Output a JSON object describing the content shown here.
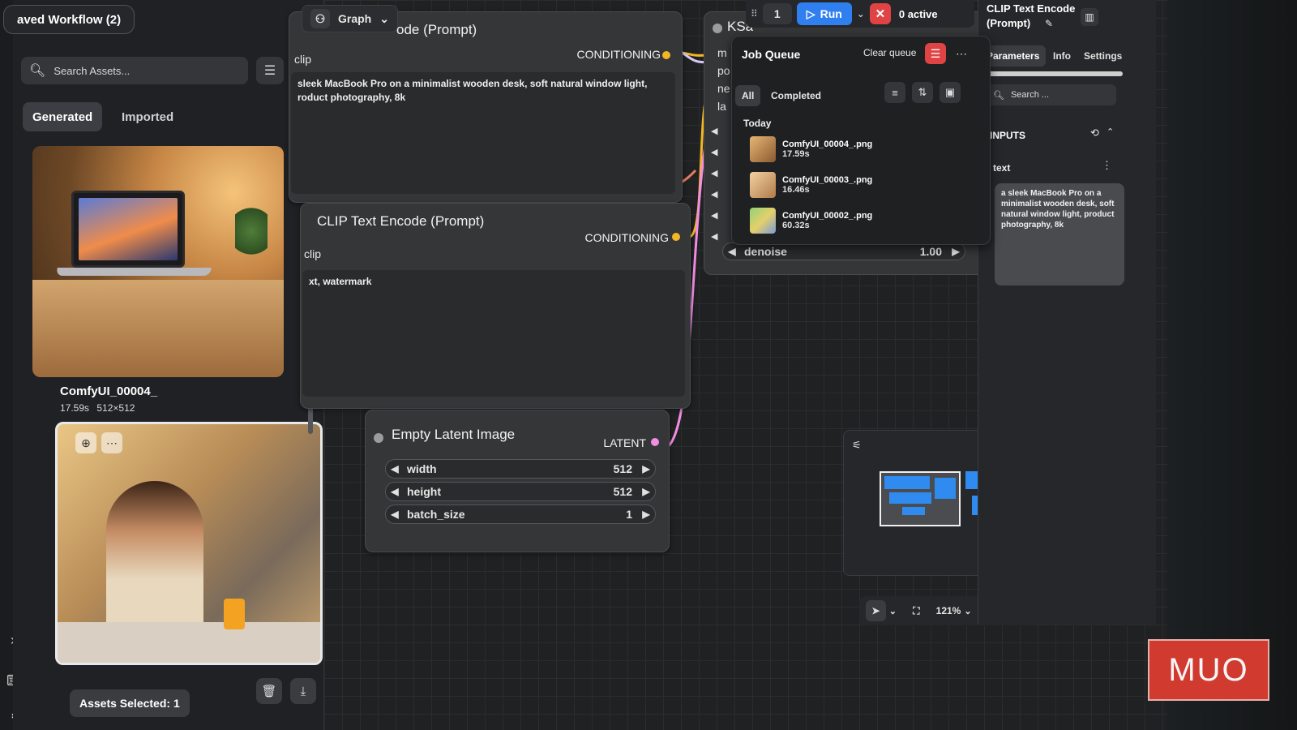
{
  "workflow_tab": "aved Workflow (2)",
  "assets": {
    "search_placeholder": "Search Assets...",
    "tabs": [
      {
        "label": "Generated",
        "active": true
      },
      {
        "label": "Imported",
        "active": false
      }
    ],
    "items": [
      {
        "name": "ComfyUI_00004_",
        "duration": "17.59s",
        "size": "512×512"
      }
    ],
    "footer": {
      "selected_label": "Assets Selected: 1"
    }
  },
  "graph_button": {
    "label": "Graph"
  },
  "nodes": {
    "positive": {
      "title": "ode (Prompt)",
      "input_label": "clip",
      "output_label": "CONDITIONING",
      "text": "sleek MacBook Pro on a minimalist wooden desk, soft natural window light, roduct photography, 8k"
    },
    "negative": {
      "title": "CLIP Text Encode (Prompt)",
      "input_label": "clip",
      "output_label": "CONDITIONING",
      "text": "xt, watermark"
    },
    "latent": {
      "title": "Empty Latent Image",
      "output_label": "LATENT",
      "widgets": [
        {
          "label": "width",
          "value": "512"
        },
        {
          "label": "height",
          "value": "512"
        },
        {
          "label": "batch_size",
          "value": "1"
        }
      ]
    },
    "ksampler": {
      "title": "KSa",
      "inputs": [
        "m",
        "po",
        "ne",
        "la"
      ],
      "last_widget_label": "denoise",
      "last_widget_value": "1.00"
    }
  },
  "run_toolbar": {
    "count": "1",
    "run_label": "Run",
    "active_label": "0 active"
  },
  "job_queue": {
    "title": "Job Queue",
    "clear_label": "Clear queue",
    "tabs": [
      {
        "label": "All",
        "active": true
      },
      {
        "label": "Completed",
        "active": false
      }
    ],
    "group_label": "Today",
    "items": [
      {
        "name": "ComfyUI_00004_.png",
        "time": "17.59s"
      },
      {
        "name": "ComfyUI_00003_.png",
        "time": "16.46s"
      },
      {
        "name": "ComfyUI_00002_.png",
        "time": "60.32s"
      }
    ]
  },
  "properties": {
    "title": "CLIP Text Encode (Prompt)",
    "tabs": [
      {
        "label": "Parameters",
        "active": true
      },
      {
        "label": "Info",
        "active": false
      },
      {
        "label": "Settings",
        "active": false
      }
    ],
    "search_placeholder": "Search ...",
    "section": "INPUTS",
    "field_label": "text",
    "field_value": "a sleek MacBook Pro on a minimalist wooden desk, soft natural window light, product photography, 8k"
  },
  "bottom_toolbar": {
    "zoom": "121%"
  },
  "brand": "MUO",
  "colors": {
    "run_blue": "#2f7ff0",
    "stop_red": "#e04343",
    "conditioning_dot": "#f3b624",
    "latent_dot": "#f28de3",
    "clip_dot": "#f2d33b"
  }
}
